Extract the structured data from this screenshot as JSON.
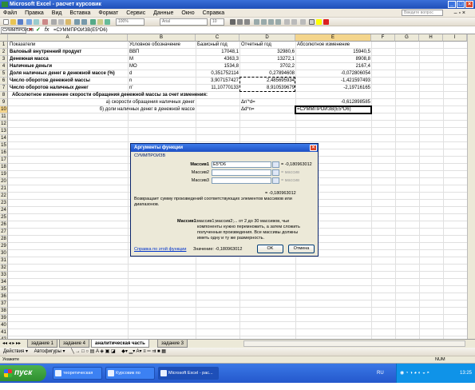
{
  "window": {
    "title": "Microsoft Excel - расчет курсовик"
  },
  "menu": {
    "items": [
      "Файл",
      "Правка",
      "Вид",
      "Вставка",
      "Формат",
      "Сервис",
      "Данные",
      "Окно",
      "Справка"
    ],
    "help_placeholder": "Введите вопрос"
  },
  "toolbar": {
    "font_combo": "Arial",
    "size_combo": "10"
  },
  "formula_bar": {
    "name_box": "СУММПРОИЗВ",
    "formula": "=СУММПРОИЗВ(E5*D6)"
  },
  "columns": [
    "A",
    "B",
    "C",
    "D",
    "E",
    "F",
    "G",
    "H",
    "I"
  ],
  "rows": [
    "1",
    "2",
    "3",
    "4",
    "5",
    "6",
    "7",
    "8",
    "9",
    "10",
    "11",
    "12",
    "13",
    "14",
    "15",
    "16",
    "17",
    "18",
    "19",
    "20",
    "21",
    "22",
    "23",
    "24",
    "25",
    "26",
    "27",
    "28",
    "29",
    "30",
    "31",
    "32",
    "33",
    "34",
    "35",
    "36",
    "37",
    "38",
    "39",
    "40",
    "41",
    "42",
    "43"
  ],
  "table": {
    "headers": [
      "Показатели",
      "Условное обозначение",
      "Базисный год",
      "Отчетный год",
      "Абсолютное изменение"
    ],
    "data_rows": [
      [
        "Валовый внутренний продукт",
        "ВВП",
        "17048,1",
        "32980,6",
        "15940,5"
      ],
      [
        "Денежная масса",
        "М",
        "4363,3",
        "13272,1",
        "8908,8"
      ],
      [
        "Наличные деньги",
        "МО",
        "1534,8",
        "3702,2",
        "2167,4"
      ],
      [
        "Доля наличных денег в денежной массе (%)",
        "d",
        "0,351752114",
        "0,27894608",
        "-0,072806054"
      ],
      [
        "Число оборотов денежной массы",
        "n",
        "3,907157427",
        "2,485695934",
        "-1,421597493"
      ],
      [
        "Число оборотов наличных денег",
        "n'",
        "11,10770133",
        "8,910539679",
        "-2,19716165"
      ]
    ],
    "row8": "Абсолютное изменение скорости обращения денежной массы за счет изменения:",
    "row9": {
      "label": "а) скорости обращения наличных денег",
      "symbol": "Δn'*d=",
      "value": "-0,612898585"
    },
    "row10": {
      "label": "б) доли наличных денег в денежной массе",
      "symbol": "Δd*n=",
      "formula": "=СУММПРОИЗВ(E5*D6)"
    }
  },
  "sheet_tabs": [
    "задание 1",
    "задание 4",
    "аналитическая часть",
    "задание 3"
  ],
  "drawing_toolbar": {
    "actions": "Действия ▾",
    "autoshapes": "Автофигуры ▾"
  },
  "status": {
    "mode": "Укажите",
    "num": "NUM"
  },
  "taskbar": {
    "start": "пуск",
    "tasks": [
      "теоретическая част...",
      "Курсовик по статис...",
      "Microsoft Excel - рас..."
    ],
    "lang": "RU",
    "clock": "13:25"
  },
  "dialog": {
    "title": "Аргументы функции",
    "function_name": "СУММПРОИЗВ",
    "args": [
      {
        "label": "Массив1",
        "value": "E5*D6",
        "result": "= -0,180963012"
      },
      {
        "label": "Массив2",
        "value": "",
        "result": "= массив"
      },
      {
        "label": "Массив3",
        "value": "",
        "result": "= массив"
      }
    ],
    "result_line": "= -0,180963012",
    "description": "Возвращает сумму произведений соответствующих элементов массивов или диапазонов.",
    "arg_help_label": "Массив1:",
    "arg_help_text": "массив1;массив2;... от 2 до 30 массивов, чьи компоненты нужно перемножить, а затем сложить полученные произведения. Все массивы должны иметь одну и ту же размерность.",
    "help_link": "Справка по этой функции",
    "value_label": "Значение: -0,180963012",
    "ok": "OK",
    "cancel": "Отмена"
  },
  "colors": {
    "title_bar": "#1f4fb8",
    "taskbar": "#2458cc",
    "start_button": "#2f8f2f",
    "selected_header": "#f4d58c",
    "dialog_bg": "#ece9d8"
  }
}
